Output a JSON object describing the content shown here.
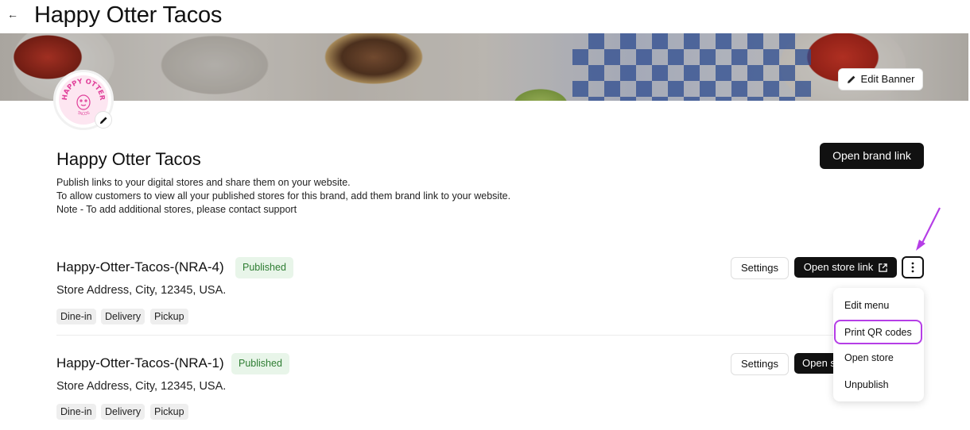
{
  "header": {
    "title": "Happy Otter Tacos"
  },
  "banner": {
    "edit_label": "Edit Banner"
  },
  "logo": {
    "text_top": "HAPPY OTTER",
    "text_bottom": "TACOS"
  },
  "brand": {
    "name": "Happy Otter Tacos",
    "open_link_label": "Open brand link",
    "description": [
      "Publish links to your digital stores and share them on your website.",
      "To allow customers to view all your published stores for this brand, add them brand link to your website.",
      "Note - To add additional stores, please contact support"
    ]
  },
  "stores": [
    {
      "name": "Happy-Otter-Tacos-(NRA-4)",
      "status": "Published",
      "address": "Store Address, City, 12345, USA.",
      "tags": [
        "Dine-in",
        "Delivery",
        "Pickup"
      ],
      "settings_label": "Settings",
      "open_label": "Open store link"
    },
    {
      "name": "Happy-Otter-Tacos-(NRA-1)",
      "status": "Published",
      "address": "Store Address, City, 12345, USA.",
      "tags": [
        "Dine-in",
        "Delivery",
        "Pickup"
      ],
      "settings_label": "Settings",
      "open_label": "Open store link"
    }
  ],
  "menu": {
    "items": [
      "Edit menu",
      "Print QR codes",
      "Open store",
      "Unpublish"
    ],
    "highlighted": "Print QR codes"
  },
  "colors": {
    "accent_highlight": "#b53ee6",
    "published_bg": "#e8f5e9",
    "published_text": "#2e7d32",
    "primary_button": "#111111"
  }
}
